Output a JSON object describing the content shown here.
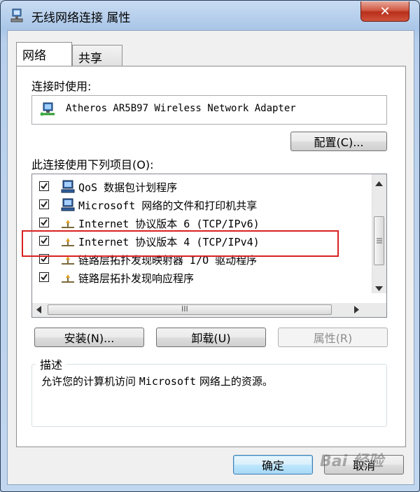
{
  "window": {
    "title": "无线网络连接 属性",
    "close_label": "✕"
  },
  "tabs": [
    {
      "label": "网络",
      "active": true
    },
    {
      "label": "共享",
      "active": false
    }
  ],
  "connect_using": {
    "label": "连接时使用:",
    "adapter_name": "Atheros AR5B97 Wireless Network Adapter",
    "configure_button": "配置(C)..."
  },
  "items_section": {
    "label": "此连接使用下列项目(O):",
    "items": [
      {
        "text": "QoS 数据包计划程序",
        "checked": true,
        "icon": "network-client-icon"
      },
      {
        "text": "Microsoft 网络的文件和打印机共享",
        "checked": true,
        "icon": "network-client-icon"
      },
      {
        "text": "Internet 协议版本 6 (TCP/IPv6)",
        "checked": true,
        "icon": "protocol-icon"
      },
      {
        "text": "Internet 协议版本 4 (TCP/IPv4)",
        "checked": true,
        "icon": "protocol-icon"
      },
      {
        "text": "链路层拓扑发现映射器 I/O 驱动程序",
        "checked": true,
        "icon": "protocol-icon"
      },
      {
        "text": "链路层拓扑发现响应程序",
        "checked": true,
        "icon": "protocol-icon"
      }
    ],
    "scroll_grip": "III"
  },
  "item_buttons": {
    "install": "安装(N)...",
    "uninstall": "卸载(U)",
    "properties": "属性(R)"
  },
  "description": {
    "legend": "描述",
    "text_before": "允许您的计算机访问 ",
    "text_mono": "Microsoft",
    "text_after": " 网络上的资源。"
  },
  "footer": {
    "ok": "确定",
    "cancel": "取消"
  },
  "watermark": "Bai 经验",
  "colors": {
    "highlight_box": "#d92121",
    "close_button": "#c63b25",
    "window_frame": "#aac6e8"
  }
}
